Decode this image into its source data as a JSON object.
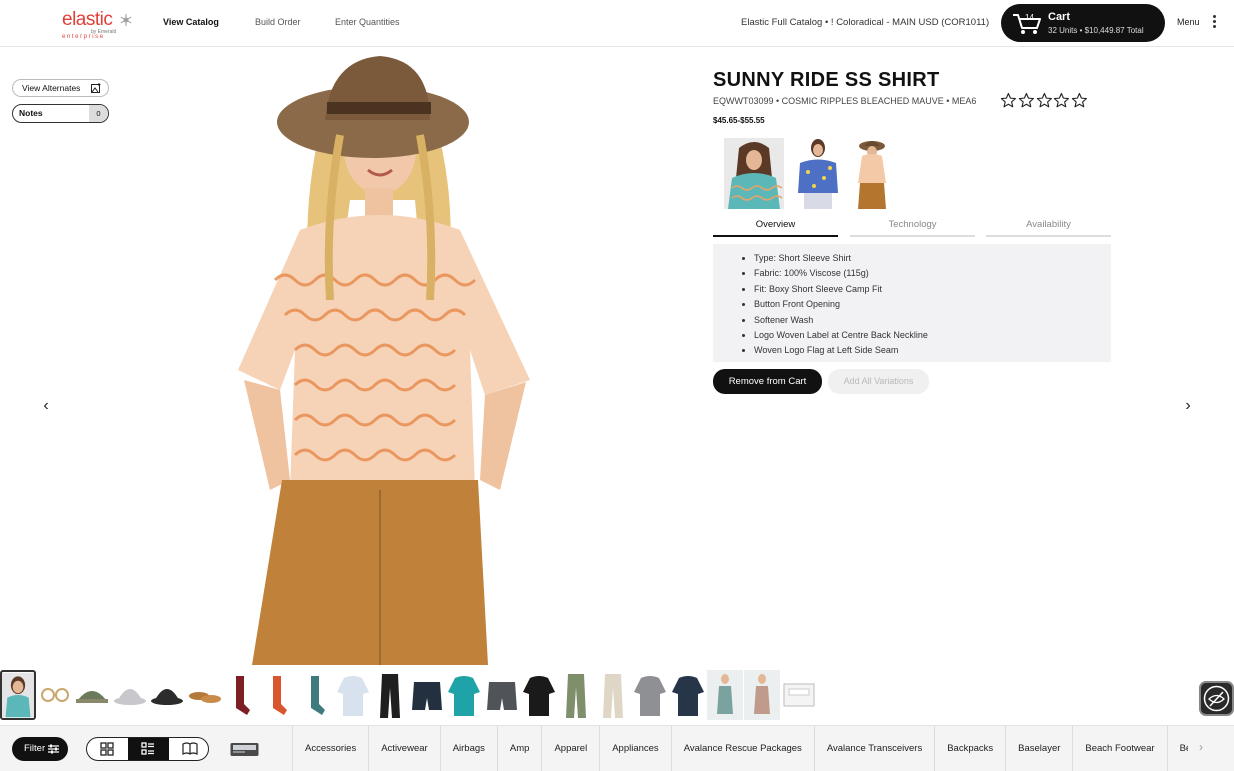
{
  "header": {
    "logo_text": "elastic",
    "logo_by": "by Emerald",
    "logo_sub": "enterprise",
    "nav": [
      "View Catalog",
      "Build Order",
      "Enter Quantities"
    ],
    "catalog_label": "Elastic Full Catalog • ! Coloradical - MAIN USD (COR1011)",
    "cart": {
      "count": "14",
      "title": "Cart",
      "summary": "32 Units • $10,449.87 Total"
    },
    "menu_label": "Menu"
  },
  "left_actions": {
    "view_alternates": "View Alternates",
    "notes_label": "Notes",
    "notes_count": "0"
  },
  "product": {
    "title": "SUNNY RIDE SS SHIRT",
    "meta": "EQWWT03099 • COSMIC RIPPLES BLEACHED MAUVE • MEA6",
    "rating": 0,
    "rating_max": 5,
    "price": "$45.65-$55.55",
    "tabs": [
      "Overview",
      "Technology",
      "Availability"
    ],
    "active_tab": "Overview",
    "features": [
      "Type: Short Sleeve Shirt",
      "Fabric: 100% Viscose (115g)",
      "Fit: Boxy Short Sleeve Camp Fit",
      "Button Front Opening",
      "Softener Wash",
      "Logo Woven Label at Centre Back Neckline",
      "Woven Logo Flag at Left Side Seam"
    ],
    "remove_button": "Remove from Cart",
    "add_all_button": "Add All Variations"
  },
  "thumbnail_icons": [
    "shirt-teal-icon",
    "sunglasses-icon",
    "cap-icon",
    "bucket-hat-icon",
    "wide-hat-icon",
    "sandal-icon",
    "socks-red-icon",
    "sock-orange-icon",
    "sock-blue-icon",
    "shirt-white-icon",
    "pants-black-icon",
    "shorts-navy-icon",
    "hoodie-teal-icon",
    "shorts-grey-icon",
    "jacket-black-icon",
    "pants-olive-icon",
    "pants-beige-icon",
    "jacket-grey-icon",
    "rashguard-navy-icon",
    "swimsuit-icon",
    "dress-icon",
    "gift-box-icon"
  ],
  "footer": {
    "filter_label": "Filter",
    "categories": [
      "Accessories",
      "Activewear",
      "Airbags",
      "Amp",
      "Apparel",
      "Appliances",
      "Avalance Rescue Packages",
      "Avalance Transceivers",
      "Backpacks",
      "Baselayer",
      "Beach Footwear",
      "Bedding",
      "B"
    ]
  },
  "colors": {
    "accent": "#e0403a",
    "dark": "#111111",
    "shirt": "#f3c9a8",
    "shorts": "#c0823a",
    "hat": "#7a5a3a"
  }
}
